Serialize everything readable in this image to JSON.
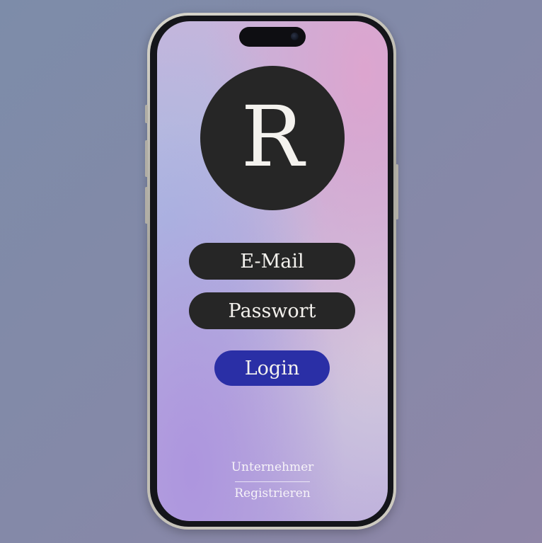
{
  "app": {
    "logo_letter": "R"
  },
  "login_form": {
    "email_label": "E-Mail",
    "password_label": "Passwort",
    "login_button_label": "Login"
  },
  "footer": {
    "company_link": "Unternehmer",
    "register_link": "Registrieren"
  },
  "colors": {
    "field_background": "#262626",
    "login_button": "#2a2fa6",
    "text_light": "#f4f2ee"
  }
}
